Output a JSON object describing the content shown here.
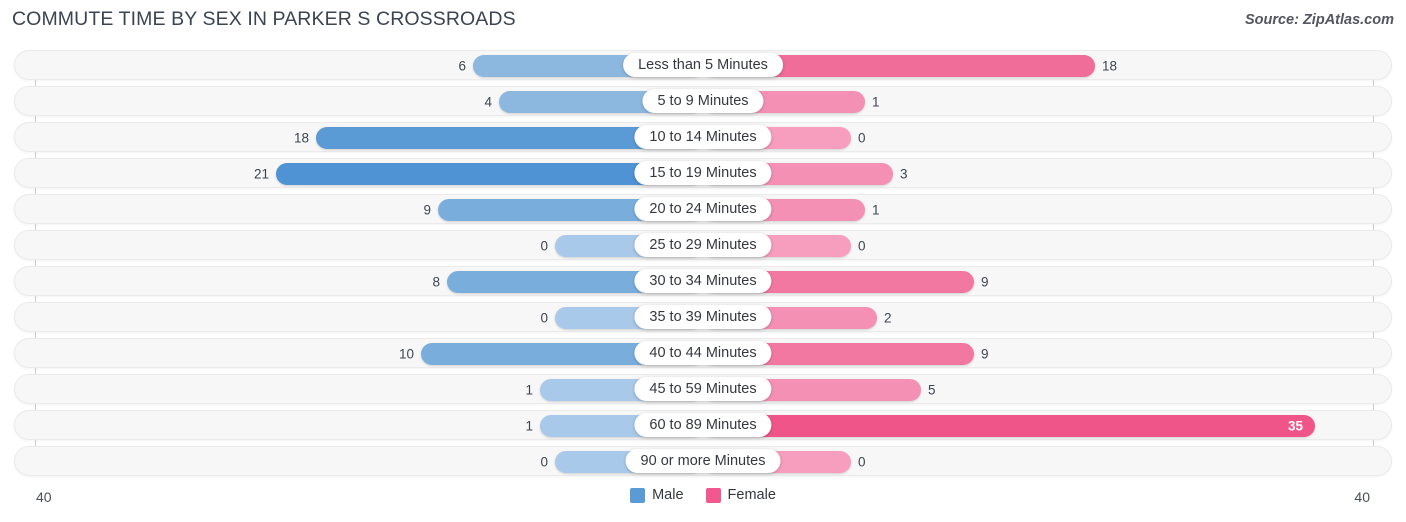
{
  "header": {
    "title": "COMMUTE TIME BY SEX IN PARKER S CROSSROADS",
    "source": "Source: ZipAtlas.com"
  },
  "axis": {
    "left_tick": "40",
    "right_tick": "40"
  },
  "legend": {
    "items": [
      {
        "label": "Male",
        "color": "#5B9BD5",
        "icon": "square-swatch-icon"
      },
      {
        "label": "Female",
        "color": "#F0588F",
        "icon": "square-swatch-icon"
      }
    ]
  },
  "chart_data": {
    "type": "bar",
    "orientation": "horizontal-diverging",
    "title": "COMMUTE TIME BY SEX IN PARKER S CROSSROADS",
    "xlabel": "",
    "ylabel": "",
    "xlim": [
      40,
      40
    ],
    "axis_max": 40,
    "grid": false,
    "legend_position": "bottom-center",
    "categories": [
      "Less than 5 Minutes",
      "5 to 9 Minutes",
      "10 to 14 Minutes",
      "15 to 19 Minutes",
      "20 to 24 Minutes",
      "25 to 29 Minutes",
      "30 to 34 Minutes",
      "35 to 39 Minutes",
      "40 to 44 Minutes",
      "45 to 59 Minutes",
      "60 to 89 Minutes",
      "90 or more Minutes"
    ],
    "series": [
      {
        "name": "Male",
        "values": [
          6,
          4,
          18,
          21,
          9,
          0,
          8,
          0,
          10,
          1,
          1,
          0
        ]
      },
      {
        "name": "Female",
        "values": [
          18,
          1,
          0,
          3,
          1,
          0,
          9,
          2,
          9,
          5,
          35,
          0
        ]
      }
    ]
  },
  "rows": [
    {
      "label": "Less than 5 Minutes",
      "male": "6",
      "female": "18",
      "male_w": 230,
      "female_w": 392,
      "male_color": "#8CB8E0",
      "female_color": "#F06C99",
      "female_inside": false
    },
    {
      "label": "5 to 9 Minutes",
      "male": "4",
      "female": "1",
      "male_w": 204,
      "female_w": 162,
      "male_color": "#8CB8E0",
      "female_color": "#F490B4",
      "female_inside": false
    },
    {
      "label": "10 to 14 Minutes",
      "male": "18",
      "female": "0",
      "male_w": 387,
      "female_w": 148,
      "male_color": "#5B9BD5",
      "female_color": "#F79DBD",
      "female_inside": false
    },
    {
      "label": "15 to 19 Minutes",
      "male": "21",
      "female": "3",
      "male_w": 427,
      "female_w": 190,
      "male_color": "#4F93D4",
      "female_color": "#F490B4",
      "female_inside": false
    },
    {
      "label": "20 to 24 Minutes",
      "male": "9",
      "female": "1",
      "male_w": 265,
      "female_w": 162,
      "male_color": "#79AEDC",
      "female_color": "#F490B4",
      "female_inside": false
    },
    {
      "label": "25 to 29 Minutes",
      "male": "0",
      "female": "0",
      "male_w": 148,
      "female_w": 148,
      "male_color": "#A9C9EA",
      "female_color": "#F79DBD",
      "female_inside": false
    },
    {
      "label": "30 to 34 Minutes",
      "male": "8",
      "female": "9",
      "male_w": 256,
      "female_w": 271,
      "male_color": "#79AEDC",
      "female_color": "#F278A2",
      "female_inside": false
    },
    {
      "label": "35 to 39 Minutes",
      "male": "0",
      "female": "2",
      "male_w": 148,
      "female_w": 174,
      "male_color": "#A9C9EA",
      "female_color": "#F490B4",
      "female_inside": false
    },
    {
      "label": "40 to 44 Minutes",
      "male": "10",
      "female": "9",
      "male_w": 282,
      "female_w": 271,
      "male_color": "#79AEDC",
      "female_color": "#F278A2",
      "female_inside": false
    },
    {
      "label": "45 to 59 Minutes",
      "male": "1",
      "female": "5",
      "male_w": 163,
      "female_w": 218,
      "male_color": "#A9C9EA",
      "female_color": "#F490B4",
      "female_inside": false
    },
    {
      "label": "60 to 89 Minutes",
      "male": "1",
      "female": "35",
      "male_w": 163,
      "female_w": 612,
      "male_color": "#A9C9EA",
      "female_color": "#F0558A",
      "female_inside": true
    },
    {
      "label": "90 or more Minutes",
      "male": "0",
      "female": "0",
      "male_w": 148,
      "female_w": 148,
      "male_color": "#A9C9EA",
      "female_color": "#F79DBD",
      "female_inside": false
    }
  ]
}
